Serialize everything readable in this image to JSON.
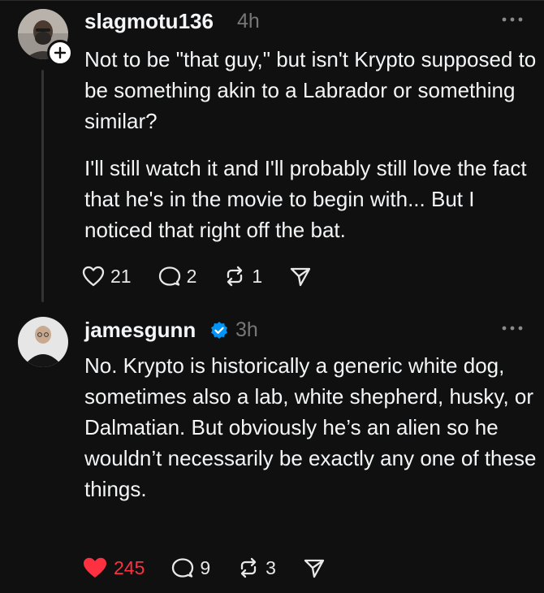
{
  "posts": [
    {
      "username": "slagmotu136",
      "time": "4h",
      "verified": false,
      "paragraphs": [
        "Not to be \"that guy,\" but isn't Krypto supposed to be something akin to a Labrador or something similar?",
        "I'll still watch it and I'll probably still love the fact that he's in the movie to begin with... But I noticed that right off the bat."
      ],
      "likes": "21",
      "liked": false,
      "replies": "2",
      "reposts": "1"
    },
    {
      "username": "jamesgunn",
      "time": "3h",
      "verified": true,
      "paragraphs": [
        "No. Krypto is historically a generic white dog, sometimes also a lab, white shepherd, husky, or Dalmatian. But obviously he’s an alien so he wouldn’t necessarily be exactly any one of these things."
      ],
      "likes": "245",
      "liked": true,
      "replies": "9",
      "reposts": "3"
    }
  ],
  "colors": {
    "background": "#101010",
    "text": "#f3f5f7",
    "muted": "#777777",
    "like_active": "#ff3040",
    "verified_badge": "#0095f6"
  }
}
